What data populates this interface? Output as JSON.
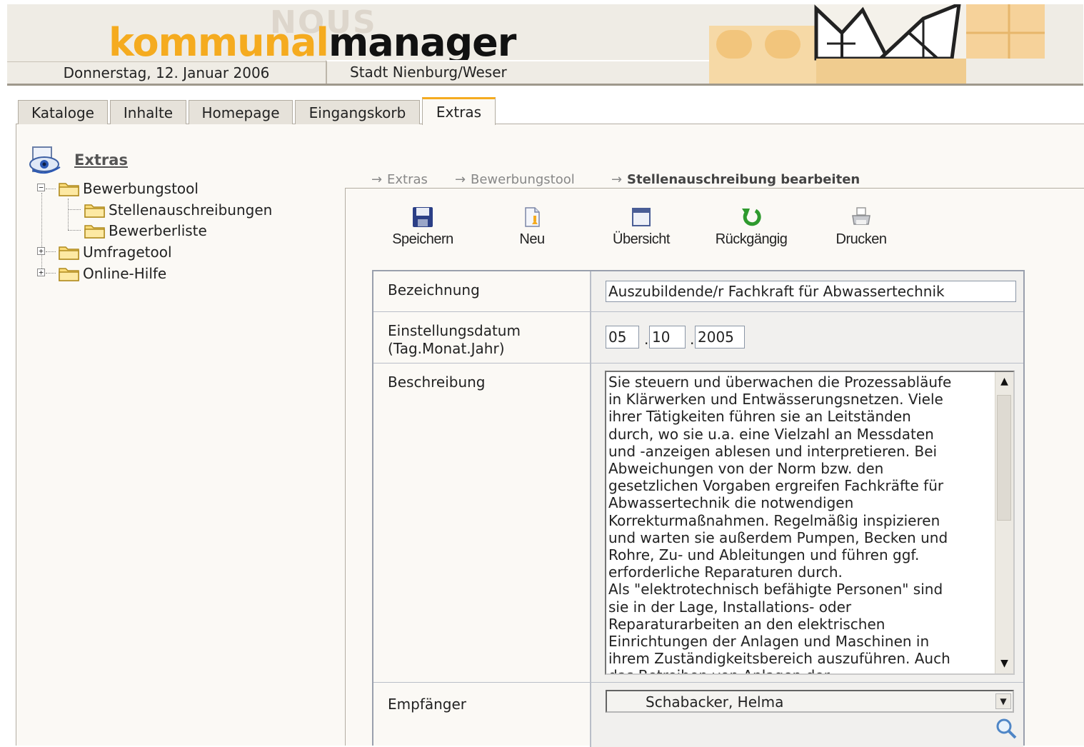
{
  "header": {
    "logo_ghost": "NOUS",
    "logo_part1": "kommunal",
    "logo_part2": "manager",
    "date": "Donnerstag, 12. Januar 2006",
    "city": "Stadt Nienburg/Weser"
  },
  "tabs": [
    {
      "label": "Kataloge"
    },
    {
      "label": "Inhalte"
    },
    {
      "label": "Homepage"
    },
    {
      "label": "Eingangskorb"
    },
    {
      "label": "Extras",
      "active": true
    }
  ],
  "tree": {
    "title": "Extras",
    "nodes": [
      {
        "label": "Bewerbungstool",
        "expanded": true
      },
      {
        "label": "Stellenauschreibungen"
      },
      {
        "label": "Bewerberliste"
      },
      {
        "label": "Umfragetool",
        "expanded": false
      },
      {
        "label": "Online-Hilfe",
        "expanded": false
      }
    ]
  },
  "breadcrumb": {
    "items": [
      "Extras",
      "Bewerbungstool",
      "Stellenauschreibung bearbeiten"
    ],
    "arrow": "→"
  },
  "toolbar": {
    "save": "Speichern",
    "new": "Neu",
    "overview": "Übersicht",
    "undo": "Rückgängig",
    "print": "Drucken"
  },
  "form": {
    "title_label": "Bezeichnung",
    "title_value": "Auszubildende/r Fachkraft für Abwassertechnik",
    "date_label": "Einstellungsdatum\n(Tag.Monat.Jahr)",
    "date_day": "05",
    "date_month": "10",
    "date_year": "2005",
    "date_separator": ".",
    "description_label": "Beschreibung",
    "description_text": "Sie steuern und überwachen die Prozessabläufe\nin Klärwerken und Entwässerungsnetzen. Viele\nihrer Tätigkeiten führen sie an Leitständen\ndurch, wo sie u.a. eine Vielzahl an Messdaten\nund -anzeigen ablesen und interpretieren. Bei\nAbweichungen von der Norm bzw. den\ngesetzlichen Vorgaben ergreifen Fachkräfte für\nAbwassertechnik die notwendigen\nKorrekturmaßnahmen. Regelmäßig inspizieren\nund warten sie außerdem Pumpen, Becken und\nRohre, Zu- und Ableitungen und führen ggf.\nerforderliche Reparaturen durch.\nAls \"elektrotechnisch befähigte Personen\" sind\nsie in der Lage, Installations- oder\nReparaturarbeiten an den elektrischen\nEinrichtungen der Anlagen und Maschinen in\nihrem Zuständigkeitsbereich auszuführen. Auch\ndas Betreiben von Anlagen der",
    "recipient_label": "Empfänger",
    "recipient_value": "Schabacker, Helma"
  },
  "colors": {
    "accent_orange": "#f5ab1f",
    "header_bg": "#efece5",
    "panel_bg": "#fbf9f5",
    "undo_green": "#2e9a2e"
  },
  "icons": {
    "tree_header": "eye-document-icon",
    "folder": "folder-icon",
    "save": "floppy-disk-icon",
    "new": "new-document-icon",
    "overview": "window-icon",
    "undo": "undo-arrow-icon",
    "print": "printer-icon",
    "recipient_search": "magnifier-icon"
  }
}
